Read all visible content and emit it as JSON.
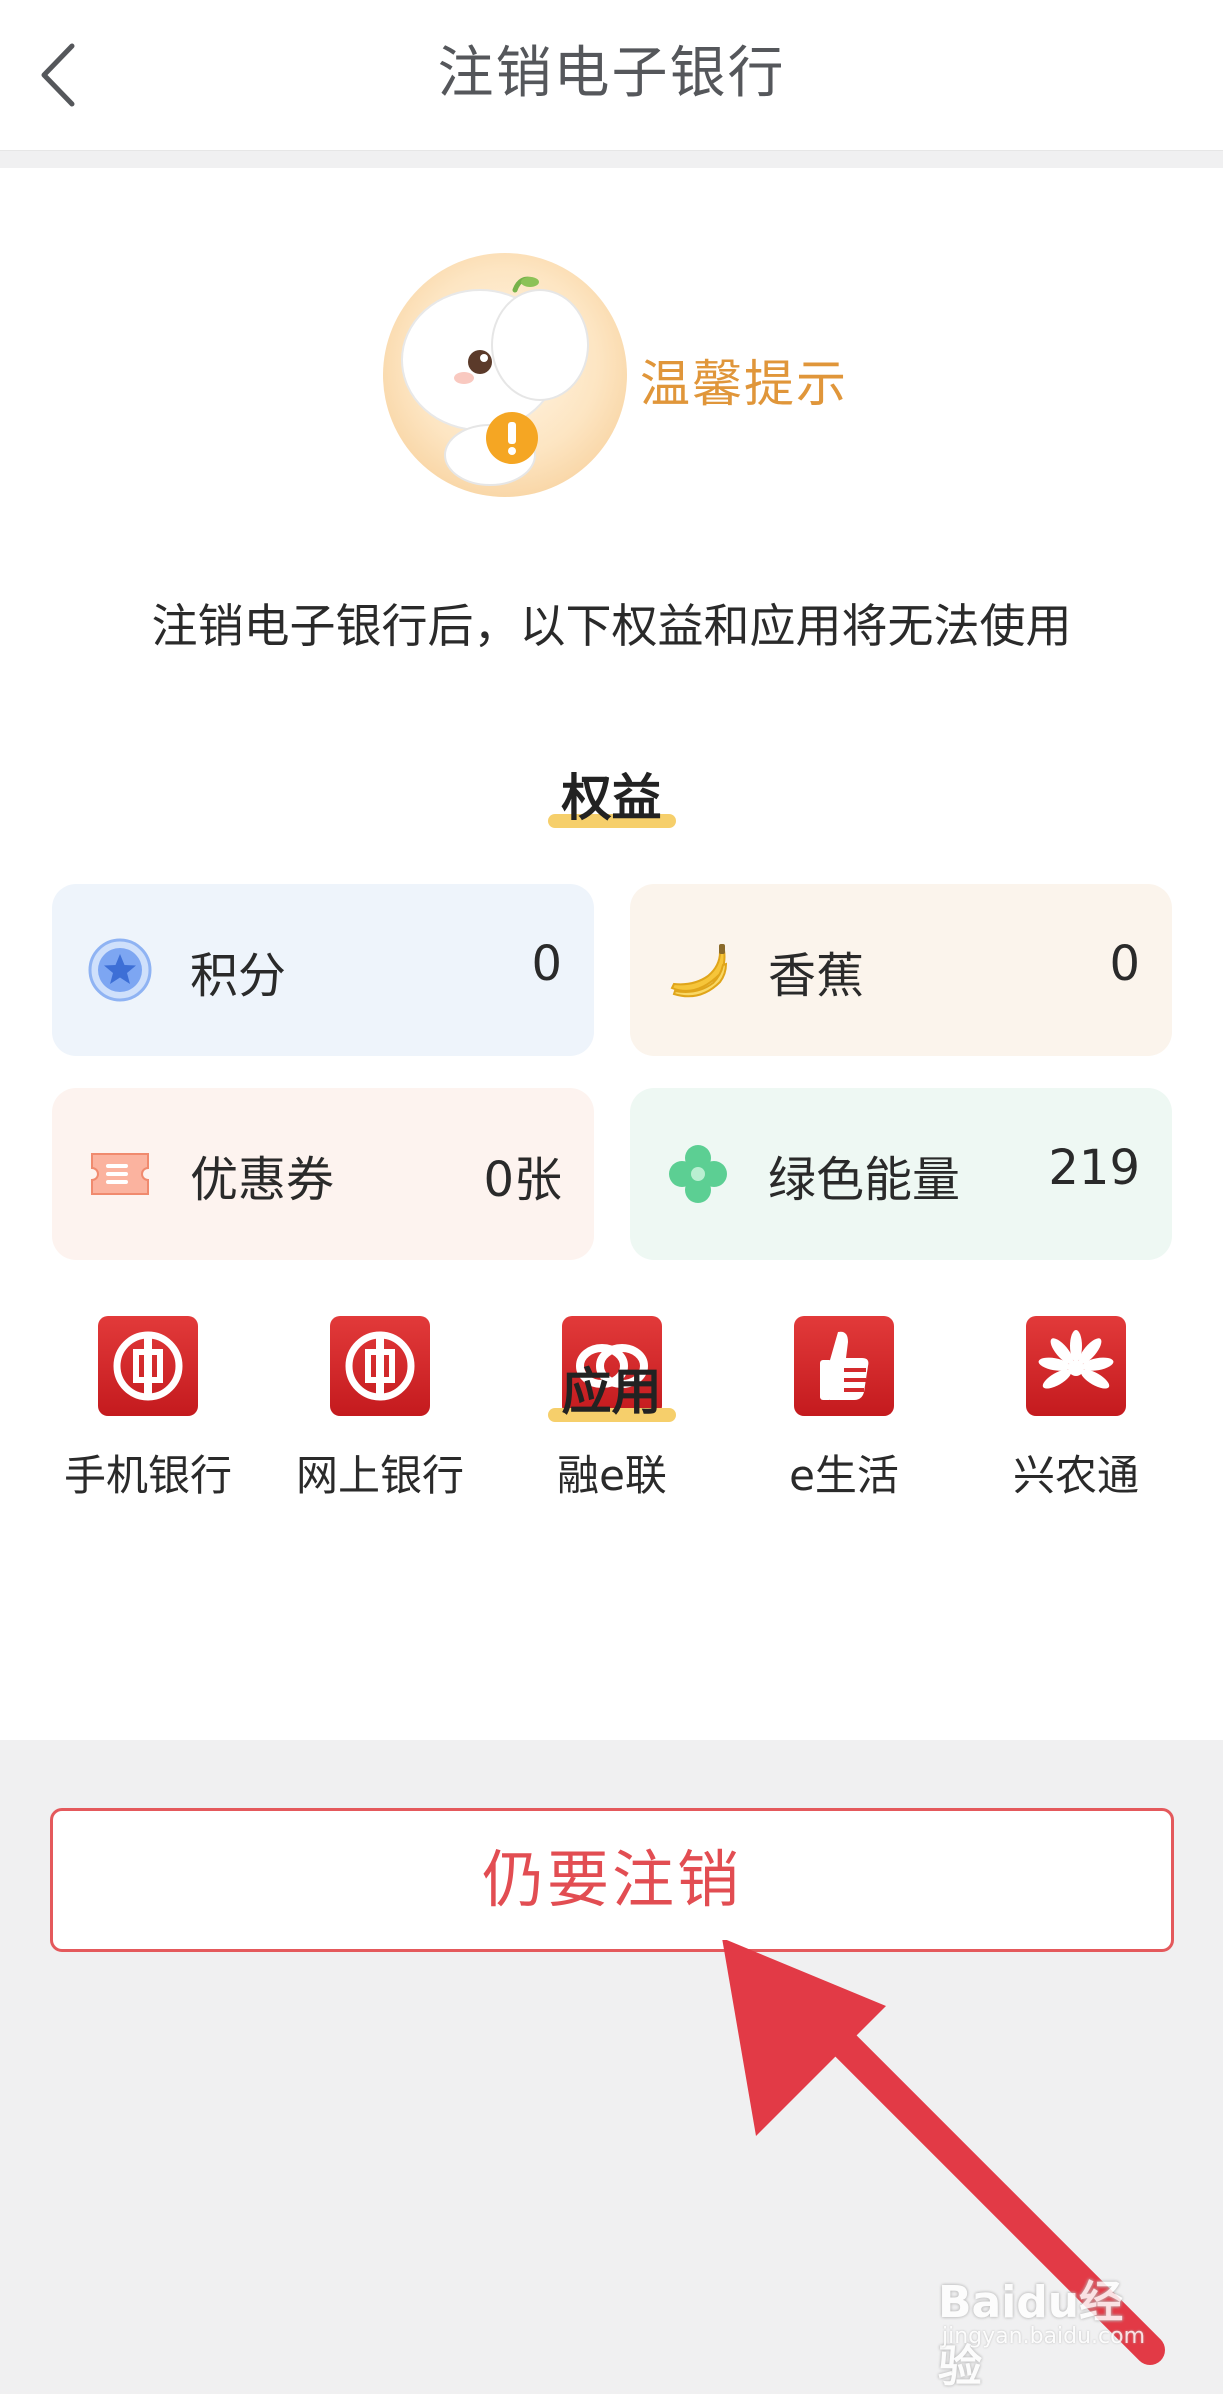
{
  "header": {
    "title": "注销电子银行"
  },
  "tip": {
    "label": "温馨提示"
  },
  "warning": "注销电子银行后，以下权益和应用将无法使用",
  "benefits": {
    "title": "权益",
    "items": [
      {
        "name": "积分",
        "value": "0",
        "icon": "star-coin-icon",
        "bg": "#eef4fb"
      },
      {
        "name": "香蕉",
        "value": "0",
        "icon": "banana-icon",
        "bg": "#fbf4ec"
      },
      {
        "name": "优惠券",
        "value": "0张",
        "icon": "coupon-icon",
        "bg": "#fdf3ef"
      },
      {
        "name": "绿色能量",
        "value": "219",
        "icon": "clover-icon",
        "bg": "#eef8f3"
      }
    ]
  },
  "apps": {
    "title": "应用",
    "items": [
      {
        "label": "手机银行",
        "icon": "icbc-logo-icon"
      },
      {
        "label": "网上银行",
        "icon": "icbc-logo-icon"
      },
      {
        "label": "融e联",
        "icon": "rings-icon"
      },
      {
        "label": "e生活",
        "icon": "thumbs-up-icon"
      },
      {
        "label": "兴农通",
        "icon": "flower-icon"
      }
    ]
  },
  "actions": {
    "cancel_label": "仍要注销"
  },
  "watermark": {
    "main": "Baidu经验",
    "sub": "jingyan.baidu.com"
  },
  "colors": {
    "accent_red": "#e24d52",
    "tip_orange": "#e0963a",
    "highlight_yellow": "#f6cf6b"
  }
}
